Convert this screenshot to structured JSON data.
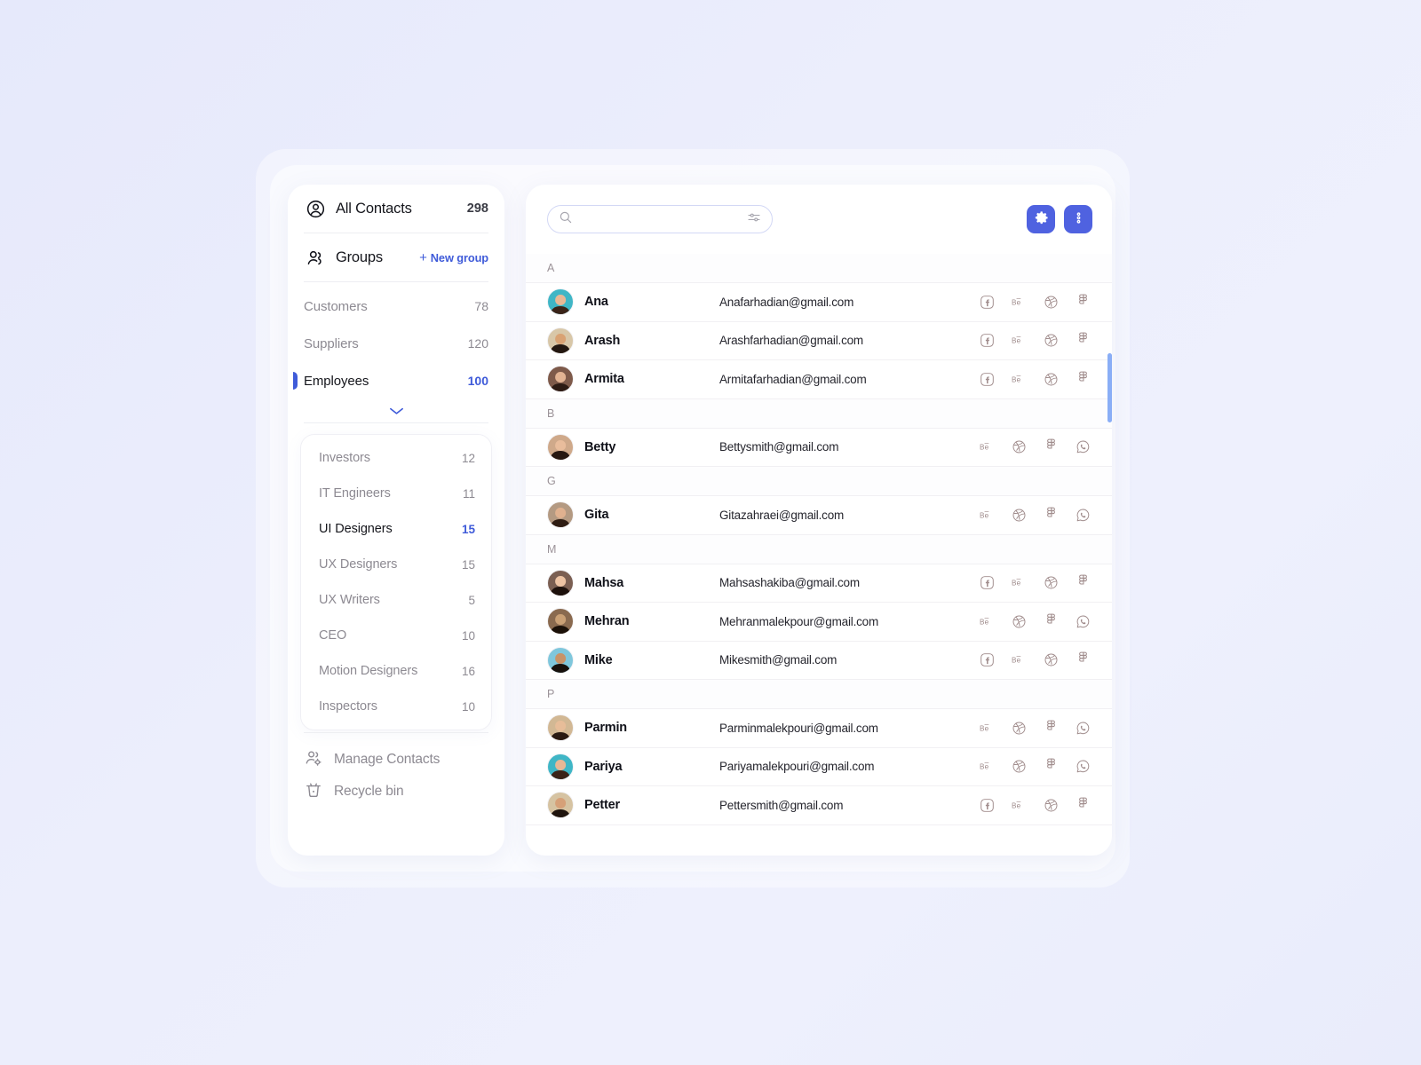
{
  "theme": {
    "accent": "#3f5bd9",
    "button_blue": "#4f62e0",
    "scrollbar": "#8aaef6",
    "page_bg": "#eceefc",
    "card_bg": "#ffffff",
    "muted_text": "#8d8a92"
  },
  "sidebar": {
    "all_contacts": {
      "label": "All Contacts",
      "count": "298",
      "icon": "user-circle-icon"
    },
    "groups": {
      "label": "Groups",
      "icon": "users-icon",
      "new_group_label": "New group",
      "new_group_plus": "+"
    },
    "top_groups": [
      {
        "label": "Customers",
        "count": "78",
        "active": false
      },
      {
        "label": "Suppliers",
        "count": "120",
        "active": false
      },
      {
        "label": "Employees",
        "count": "100",
        "active": true
      }
    ],
    "subgroups": [
      {
        "label": "Investors",
        "count": "12",
        "active": false
      },
      {
        "label": "IT Engineers",
        "count": "11",
        "active": false
      },
      {
        "label": "UI Designers",
        "count": "15",
        "active": true
      },
      {
        "label": "UX Designers",
        "count": "15",
        "active": false
      },
      {
        "label": "UX Writers",
        "count": "5",
        "active": false
      },
      {
        "label": "CEO",
        "count": "10",
        "active": false
      },
      {
        "label": "Motion Designers",
        "count": "16",
        "active": false
      },
      {
        "label": "Inspectors",
        "count": "10",
        "active": false
      }
    ],
    "footer": [
      {
        "label": "Manage Contacts",
        "icon": "users-gear-icon"
      },
      {
        "label": "Recycle bin",
        "icon": "trash-icon"
      }
    ]
  },
  "toolbar": {
    "search": {
      "value": "",
      "placeholder": "",
      "icon": "search-icon",
      "filter_icon": "sliders-icon"
    },
    "settings_button": {
      "icon": "gear-icon",
      "label": ""
    },
    "more_button": {
      "icon": "dots-vertical-icon",
      "label": ""
    }
  },
  "contacts": [
    {
      "type": "letter",
      "label": "A"
    },
    {
      "type": "row",
      "name": "Ana",
      "email": "Anafarhadian@gmail.com",
      "avatar": {
        "bg": "#3fb6c6",
        "skin": "#e8b896",
        "hair": "#3a2318"
      },
      "socials": [
        "facebook",
        "behance",
        "dribbble",
        "figma"
      ]
    },
    {
      "type": "row",
      "name": "Arash",
      "email": "Arashfarhadian@gmail.com",
      "avatar": {
        "bg": "#d8c7a8",
        "skin": "#d9a273",
        "hair": "#231710"
      },
      "socials": [
        "facebook",
        "behance",
        "dribbble",
        "figma"
      ]
    },
    {
      "type": "row",
      "name": "Armita",
      "email": "Armitafarhadian@gmail.com",
      "avatar": {
        "bg": "#7e5a4a",
        "skin": "#e2b393",
        "hair": "#2d1b14"
      },
      "socials": [
        "facebook",
        "behance",
        "dribbble",
        "figma"
      ]
    },
    {
      "type": "letter",
      "label": "B"
    },
    {
      "type": "row",
      "name": "Betty",
      "email": "Bettysmith@gmail.com",
      "avatar": {
        "bg": "#cfa98a",
        "skin": "#e9bd9c",
        "hair": "#271811"
      },
      "socials": [
        "behance",
        "dribbble",
        "figma",
        "whatsapp"
      ]
    },
    {
      "type": "letter",
      "label": "G"
    },
    {
      "type": "row",
      "name": "Gita",
      "email": "Gitazahraei@gmail.com",
      "avatar": {
        "bg": "#b49a82",
        "skin": "#e0b18f",
        "hair": "#2f1d13"
      },
      "socials": [
        "behance",
        "dribbble",
        "figma",
        "whatsapp"
      ]
    },
    {
      "type": "letter",
      "label": "M"
    },
    {
      "type": "row",
      "name": "Mahsa",
      "email": "Mahsashakiba@gmail.com",
      "avatar": {
        "bg": "#7b5f52",
        "skin": "#edc3a3",
        "hair": "#1d110c"
      },
      "socials": [
        "facebook",
        "behance",
        "dribbble",
        "figma"
      ]
    },
    {
      "type": "row",
      "name": "Mehran",
      "email": "Mehranmalekpour@gmail.com",
      "avatar": {
        "bg": "#8a6a4f",
        "skin": "#caa075",
        "hair": "#1b1008"
      },
      "socials": [
        "behance",
        "dribbble",
        "figma",
        "whatsapp"
      ]
    },
    {
      "type": "row",
      "name": "Mike",
      "email": "Mikesmith@gmail.com",
      "avatar": {
        "bg": "#7fc7dc",
        "skin": "#c89368",
        "hair": "#17110c"
      },
      "socials": [
        "facebook",
        "behance",
        "dribbble",
        "figma"
      ]
    },
    {
      "type": "letter",
      "label": "P"
    },
    {
      "type": "row",
      "name": "Parmin",
      "email": "Parminmalekpouri@gmail.com",
      "avatar": {
        "bg": "#d2b894",
        "skin": "#e7bd99",
        "hair": "#2a1a12"
      },
      "socials": [
        "behance",
        "dribbble",
        "figma",
        "whatsapp"
      ]
    },
    {
      "type": "row",
      "name": "Pariya",
      "email": "Pariyamalekpouri@gmail.com",
      "avatar": {
        "bg": "#3fb6c6",
        "skin": "#e8b896",
        "hair": "#3a2318"
      },
      "socials": [
        "behance",
        "dribbble",
        "figma",
        "whatsapp"
      ]
    },
    {
      "type": "row",
      "name": "Petter",
      "email": "Pettersmith@gmail.com",
      "avatar": {
        "bg": "#d6c3a2",
        "skin": "#d6a078",
        "hair": "#1f140d"
      },
      "socials": [
        "facebook",
        "behance",
        "dribbble",
        "figma"
      ]
    }
  ]
}
